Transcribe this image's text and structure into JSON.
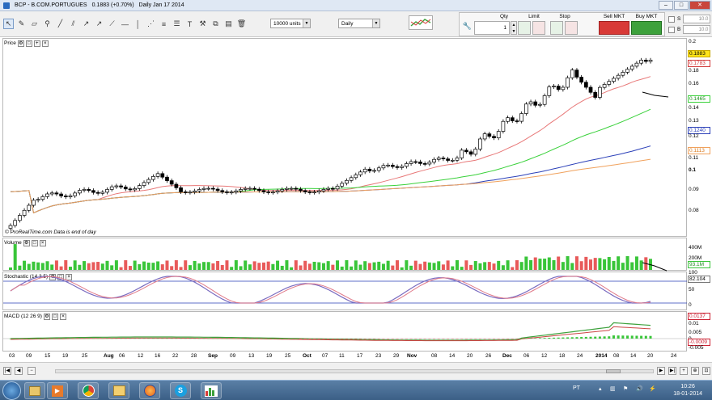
{
  "window": {
    "title": "BCP - B.COM.PORTUGUES",
    "change": "0.1883 (+0.70%)",
    "period": "Daily  Jan 17 2014",
    "minimize": "–",
    "maximize": "□",
    "close": "✕"
  },
  "toolbar": {
    "units": "10000 units",
    "interval": "Daily"
  },
  "order_panel": {
    "qty_label": "Qty",
    "qty_value": "1",
    "limit_label": "Limit",
    "stop_label": "Stop",
    "sell_label": "Sell MKT",
    "buy_label": "Buy MKT",
    "s_label": "S",
    "b_label": "B",
    "s_value": "10.0",
    "b_value": "10.0"
  },
  "price_panel": {
    "label": "Price",
    "ticks": [
      "0.2",
      "0.18",
      "0.16",
      "0.14",
      "0.13",
      "0.12",
      "0.11",
      "0.1",
      "0.09",
      "0.08"
    ],
    "last_price": "0.1883",
    "ma_tags": [
      "0.1783",
      "0.1465",
      "0.1240",
      "0.1113"
    ],
    "source": "© ProRealTime.com  Data is end of day"
  },
  "volume_panel": {
    "label": "Volume",
    "ticks": [
      "400M",
      "200M"
    ],
    "last": "93.1M"
  },
  "stochastic_panel": {
    "label": "Stochastic (14 3 5)",
    "ticks": [
      "100",
      "50",
      "0"
    ],
    "last": "82.104"
  },
  "macd_panel": {
    "label": "MACD (12 26 9)",
    "ticks": [
      "0.01",
      "0.005",
      "0",
      "-0.005"
    ],
    "tags": [
      "0.0137",
      "-0.0009"
    ]
  },
  "dates": [
    "03",
    "09",
    "15",
    "19",
    "25",
    "Aug",
    "06",
    "12",
    "16",
    "22",
    "28",
    "Sep",
    "09",
    "13",
    "19",
    "25",
    "Oct",
    "07",
    "11",
    "17",
    "23",
    "29",
    "Nov",
    "08",
    "14",
    "20",
    "26",
    "Dec",
    "06",
    "12",
    "18",
    "24",
    "2014",
    "08",
    "14",
    "20",
    "24"
  ],
  "taskbar": {
    "lang": "PT",
    "time": "10:26",
    "date": "18-01-2014"
  },
  "colors": {
    "ma_short": "#e87878",
    "ma_mid": "#39d13a",
    "ma_long": "#2a3fb8",
    "ma_longest": "#f0a15c",
    "volume_up": "#39c539",
    "volume_down": "#e85a5a",
    "sell": "#d83a37",
    "buy": "#3da13c"
  }
}
